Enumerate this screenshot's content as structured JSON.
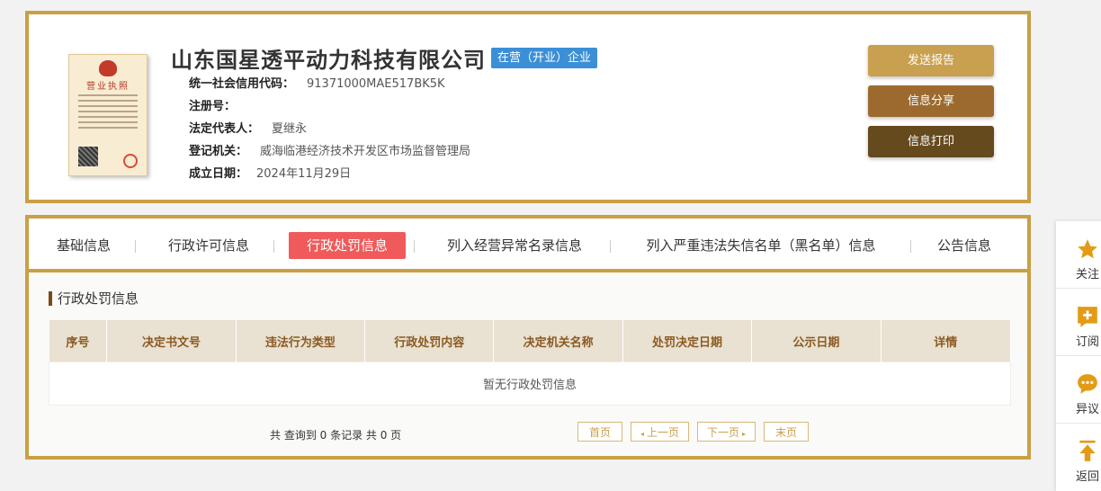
{
  "company": {
    "name": "山东国星透平动力科技有限公司",
    "status": "在营（开业）企业",
    "license_title": "营业执照",
    "fields": [
      {
        "label": "统一社会信用代码：",
        "value": "91371000MAE517BK5K"
      },
      {
        "label": "注册号：",
        "value": ""
      },
      {
        "label": "法定代表人：",
        "value": "夏继永"
      },
      {
        "label": "登记机关：",
        "value": "威海临港经济技术开发区市场监督管理局"
      },
      {
        "label": "成立日期：",
        "value": "2024年11月29日"
      }
    ]
  },
  "actions": {
    "send": "发送报告",
    "share": "信息分享",
    "print": "信息打印"
  },
  "tabs": [
    "基础信息",
    "行政许可信息",
    "行政处罚信息",
    "列入经营异常名录信息",
    "列入严重违法失信名单（黑名单）信息",
    "公告信息"
  ],
  "active_tab": "行政处罚信息",
  "section": {
    "title": "行政处罚信息"
  },
  "table": {
    "headers": [
      "序号",
      "决定书文号",
      "违法行为类型",
      "行政处罚内容",
      "决定机关名称",
      "处罚决定日期",
      "公示日期",
      "详情"
    ],
    "empty_text": "暂无行政处罚信息"
  },
  "pager": {
    "info": "共 查询到 0 条记录 共 0 页",
    "first": "首页",
    "prev": "上一页",
    "next": "下一页",
    "last": "末页"
  },
  "sidebar": [
    "关注",
    "订阅",
    "异议",
    "返回"
  ],
  "colors": {
    "gold_border": "#c9a043",
    "active_tab": "#f05a5a",
    "status_badge": "#3b8fd6"
  }
}
